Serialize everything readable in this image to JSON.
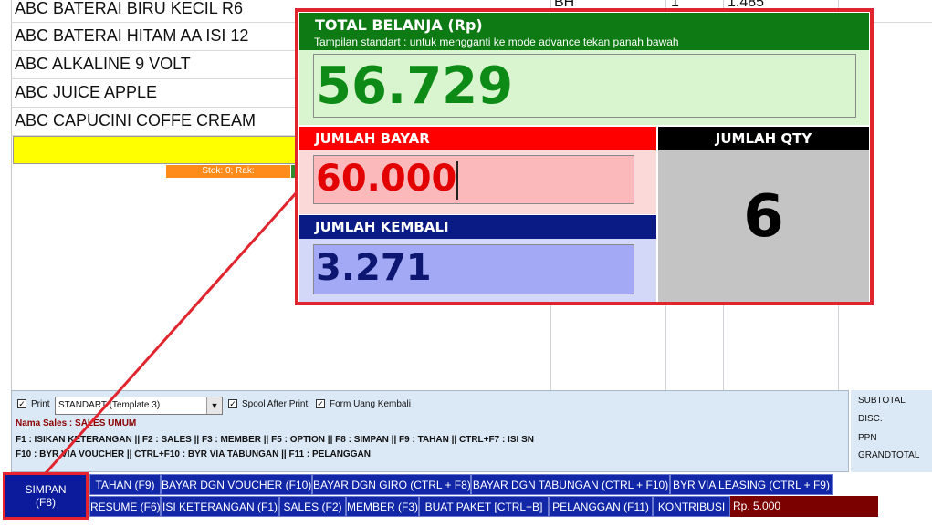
{
  "items": [
    {
      "name": "ABC BATERAI BIRU KECIL R6",
      "unit": "BH",
      "qty": "1",
      "price": "1.485"
    },
    {
      "name": "ABC BATERAI HITAM AA ISI 12"
    },
    {
      "name": "ABC ALKALINE 9 VOLT"
    },
    {
      "name": "ABC JUICE APPLE"
    },
    {
      "name": "ABC CAPUCINI COFFE CREAM"
    }
  ],
  "stock_info": "Stok: 0; Rak:",
  "total": {
    "title": "TOTAL BELANJA (Rp)",
    "subtitle": "Tampilan standart : untuk mengganti ke mode advance tekan panah bawah",
    "value": "56.729"
  },
  "bayar": {
    "title": "JUMLAH BAYAR",
    "value": "60.000"
  },
  "kembali": {
    "title": "JUMLAH KEMBALI",
    "value": "3.271"
  },
  "qty": {
    "title": "JUMLAH QTY",
    "value": "6"
  },
  "options": {
    "print_label": "Print",
    "print_template": "STANDART (Template 3)",
    "spool_label": "Spool After Print",
    "form_uang_label": "Form Uang Kembali",
    "sales_line": "Nama Sales : SALES UMUM",
    "keys_line1": "F1 : ISIKAN KETERANGAN || F2 : SALES || F3 : MEMBER || F5 : OPTION || F8 : SIMPAN || F9 : TAHAN || CTRL+F7 : ISI SN",
    "keys_line2": "F10 : BYR VIA VOUCHER || CTRL+F10 : BYR VIA TABUNGAN || F11 : PELANGGAN"
  },
  "summary": {
    "subtotal": "SUBTOTAL",
    "disc": "DISC.",
    "ppn": "PPN",
    "grandtotal": "GRANDTOTAL"
  },
  "buttons": {
    "simpan_line1": "SIMPAN",
    "simpan_line2": "(F8)",
    "row1": [
      "TAHAN (F9)",
      "BAYAR DGN VOUCHER (F10)",
      "BAYAR DGN GIRO (CTRL + F8)",
      "BAYAR DGN TABUNGAN (CTRL + F10)",
      "BYR VIA LEASING (CTRL + F9)"
    ],
    "row2": [
      "RESUME (F6)",
      "ISI KETERANGAN (F1)",
      "SALES (F2)",
      "MEMBER (F3)",
      "BUAT PAKET [CTRL+B]",
      "PELANGGAN (F11)",
      "KONTRIBUSI"
    ],
    "rp_value": "Rp. 5.000"
  },
  "colors": {
    "accent_red": "#e0252e",
    "total_green": "#0d7a14",
    "bayar_red": "#ff0000",
    "kembali_blue": "#0b1b86",
    "button_blue": "#1226a8"
  }
}
